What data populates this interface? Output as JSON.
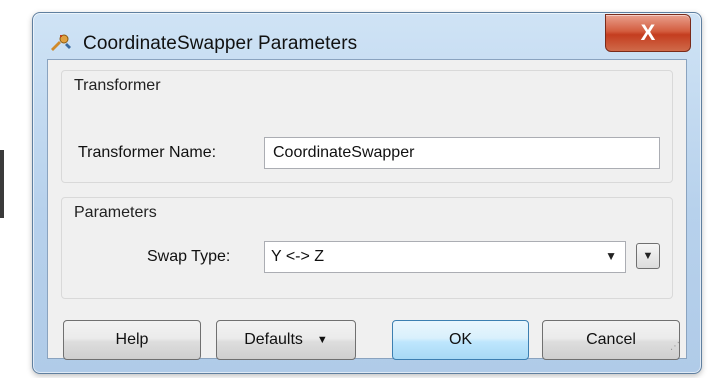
{
  "window": {
    "title": "CoordinateSwapper Parameters",
    "close_glyph": "X",
    "icon": "transformer-icon"
  },
  "transformer_group": {
    "title": "Transformer",
    "name_label": "Transformer Name:",
    "name_value": "CoordinateSwapper"
  },
  "parameters_group": {
    "title": "Parameters",
    "swap_type_label": "Swap Type:",
    "swap_type_value": "Y <-> Z"
  },
  "buttons": {
    "help": "Help",
    "defaults": "Defaults",
    "ok": "OK",
    "cancel": "Cancel"
  },
  "colors": {
    "title_bar": "#b7d1ec",
    "close_button": "#c43d1f",
    "ok_button_border": "#3c7fb1"
  }
}
